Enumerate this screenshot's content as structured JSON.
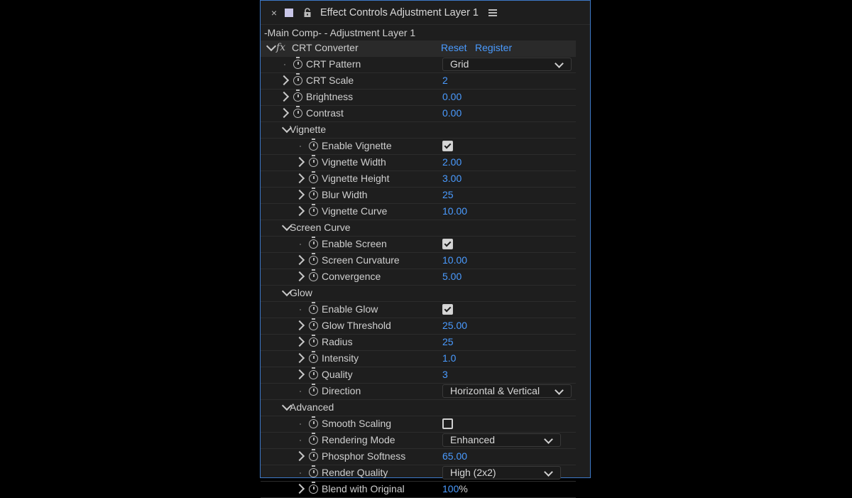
{
  "window": {
    "close_glyph": "×",
    "title": "Effect Controls Adjustment Layer 1",
    "subhead": "-Main Comp- - Adjustment Layer 1"
  },
  "effect": {
    "name": "CRT Converter",
    "fx_glyph": "fx",
    "reset": "Reset",
    "register": "Register"
  },
  "rows": [
    {
      "kind": "param",
      "depth": 0,
      "expander": false,
      "label": "CRT Pattern",
      "type": "dropdown",
      "value": "Grid",
      "dd_width": 182
    },
    {
      "kind": "param",
      "depth": 0,
      "expander": true,
      "label": "CRT Scale",
      "type": "number",
      "value": "2"
    },
    {
      "kind": "param",
      "depth": 0,
      "expander": true,
      "label": "Brightness",
      "type": "number",
      "value": "0.00"
    },
    {
      "kind": "param",
      "depth": 0,
      "expander": true,
      "label": "Contrast",
      "type": "number",
      "value": "0.00"
    },
    {
      "kind": "group",
      "label": "Vignette"
    },
    {
      "kind": "param",
      "depth": 1,
      "expander": false,
      "label": "Enable Vignette",
      "type": "checkbox",
      "checked": true
    },
    {
      "kind": "param",
      "depth": 1,
      "expander": true,
      "label": "Vignette Width",
      "type": "number",
      "value": "2.00"
    },
    {
      "kind": "param",
      "depth": 1,
      "expander": true,
      "label": "Vignette Height",
      "type": "number",
      "value": "3.00"
    },
    {
      "kind": "param",
      "depth": 1,
      "expander": true,
      "label": "Blur Width",
      "type": "number",
      "value": "25"
    },
    {
      "kind": "param",
      "depth": 1,
      "expander": true,
      "label": "Vignette Curve",
      "type": "number",
      "value": "10.00"
    },
    {
      "kind": "group",
      "label": "Screen Curve"
    },
    {
      "kind": "param",
      "depth": 1,
      "expander": false,
      "label": "Enable Screen",
      "type": "checkbox",
      "checked": true
    },
    {
      "kind": "param",
      "depth": 1,
      "expander": true,
      "label": "Screen Curvature",
      "type": "number",
      "value": "10.00"
    },
    {
      "kind": "param",
      "depth": 1,
      "expander": true,
      "label": "Convergence",
      "type": "number",
      "value": "5.00"
    },
    {
      "kind": "group",
      "label": "Glow"
    },
    {
      "kind": "param",
      "depth": 1,
      "expander": false,
      "label": "Enable Glow",
      "type": "checkbox",
      "checked": true
    },
    {
      "kind": "param",
      "depth": 1,
      "expander": true,
      "label": "Glow Threshold",
      "type": "number",
      "value": "25.00"
    },
    {
      "kind": "param",
      "depth": 1,
      "expander": true,
      "label": "Radius",
      "type": "number",
      "value": "25"
    },
    {
      "kind": "param",
      "depth": 1,
      "expander": true,
      "label": "Intensity",
      "type": "number",
      "value": "1.0"
    },
    {
      "kind": "param",
      "depth": 1,
      "expander": true,
      "label": "Quality",
      "type": "number",
      "value": "3"
    },
    {
      "kind": "param",
      "depth": 1,
      "expander": false,
      "label": "Direction",
      "type": "dropdown",
      "value": "Horizontal & Vertical",
      "dd_width": 182
    },
    {
      "kind": "group",
      "label": "Advanced"
    },
    {
      "kind": "param",
      "depth": 1,
      "expander": false,
      "label": "Smooth Scaling",
      "type": "checkbox",
      "checked": false
    },
    {
      "kind": "param",
      "depth": 1,
      "expander": false,
      "label": "Rendering Mode",
      "type": "dropdown",
      "value": "Enhanced",
      "dd_width": 167
    },
    {
      "kind": "param",
      "depth": 1,
      "expander": true,
      "label": "Phosphor Softness",
      "type": "number",
      "value": "65.00"
    },
    {
      "kind": "param",
      "depth": 1,
      "expander": false,
      "label": "Render Quality",
      "type": "dropdown",
      "value": "High (2x2)",
      "dd_width": 167
    },
    {
      "kind": "param",
      "depth": 1,
      "expander": true,
      "label": "Blend with Original",
      "type": "number",
      "value": "100",
      "unit": "%"
    }
  ]
}
